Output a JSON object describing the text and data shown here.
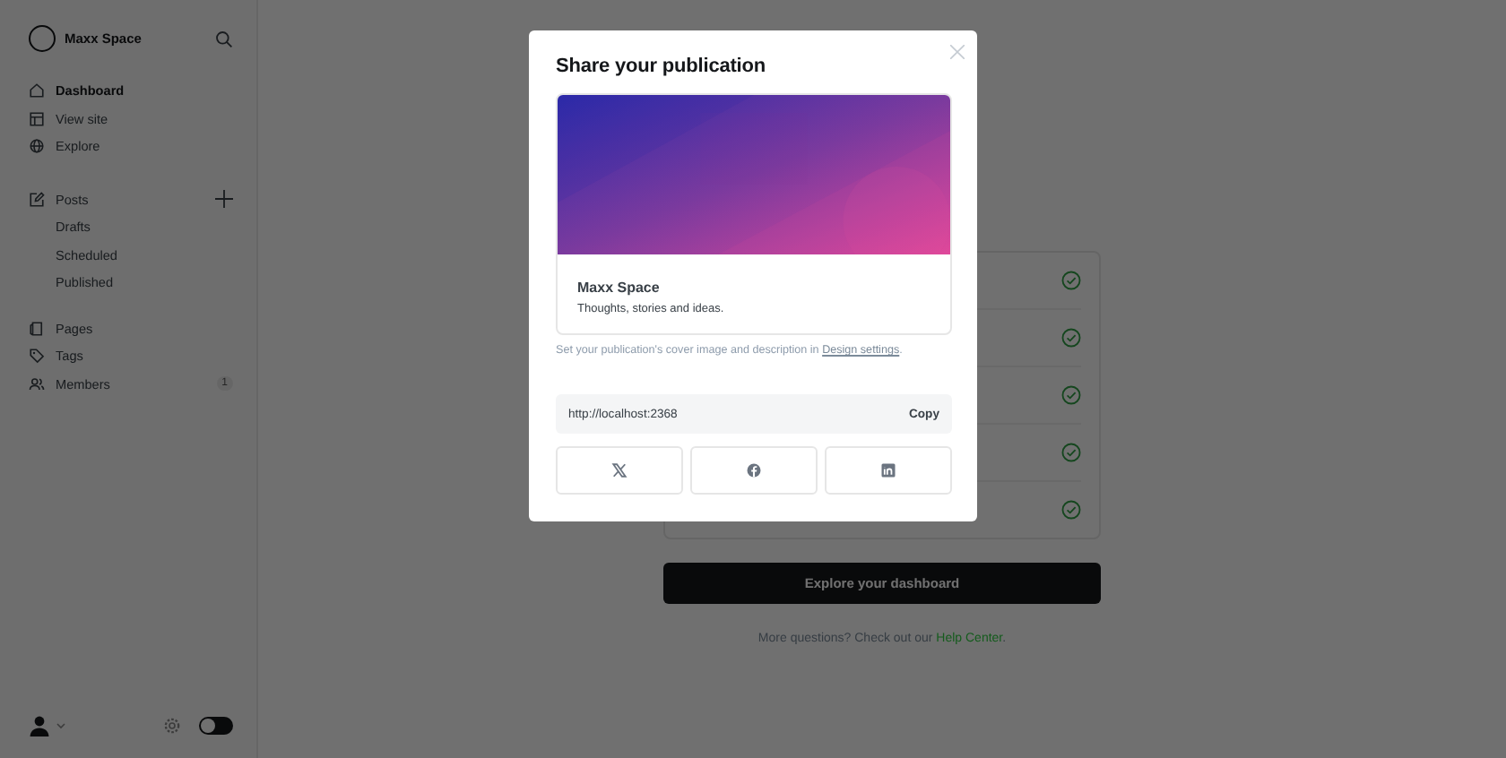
{
  "sidebar": {
    "site_title": "Maxx Space",
    "nav": [
      {
        "label": "Dashboard",
        "kind": "home",
        "selected": true
      },
      {
        "label": "View site",
        "kind": "layout",
        "selected": false
      },
      {
        "label": "Explore",
        "kind": "globe",
        "selected": false
      }
    ],
    "posts": {
      "label": "Posts",
      "kind": "edit",
      "children": [
        {
          "label": "Drafts"
        },
        {
          "label": "Scheduled"
        },
        {
          "label": "Published"
        }
      ]
    },
    "nav2": [
      {
        "label": "Pages",
        "kind": "pages",
        "selected": false
      },
      {
        "label": "Tags",
        "kind": "tag",
        "selected": false
      },
      {
        "label": "Members",
        "kind": "people",
        "selected": false,
        "badge": "1"
      }
    ],
    "dark_mode": {
      "on": false
    }
  },
  "checklist": [
    {
      "completed": true
    },
    {
      "completed": true
    },
    {
      "completed": true
    },
    {
      "completed": true
    },
    {
      "completed": true
    }
  ],
  "primary_button": "Explore your dashboard",
  "help": {
    "text": "More questions? Check out our ",
    "link": "Help Center",
    "end": "."
  },
  "modal": {
    "title": "Share your publication",
    "cover": {
      "kind": "picture",
      "site_title": "Maxx Space",
      "description": "Thoughts, stories and ideas."
    },
    "caption": {
      "text": "Set your publication's cover image and description in ",
      "link": "Design settings",
      "end": "."
    },
    "url": "http://localhost:2368",
    "copy_button": "Copy",
    "share": [
      {
        "kind": "x"
      },
      {
        "kind": "facebook"
      },
      {
        "kind": "linkedin"
      }
    ]
  }
}
